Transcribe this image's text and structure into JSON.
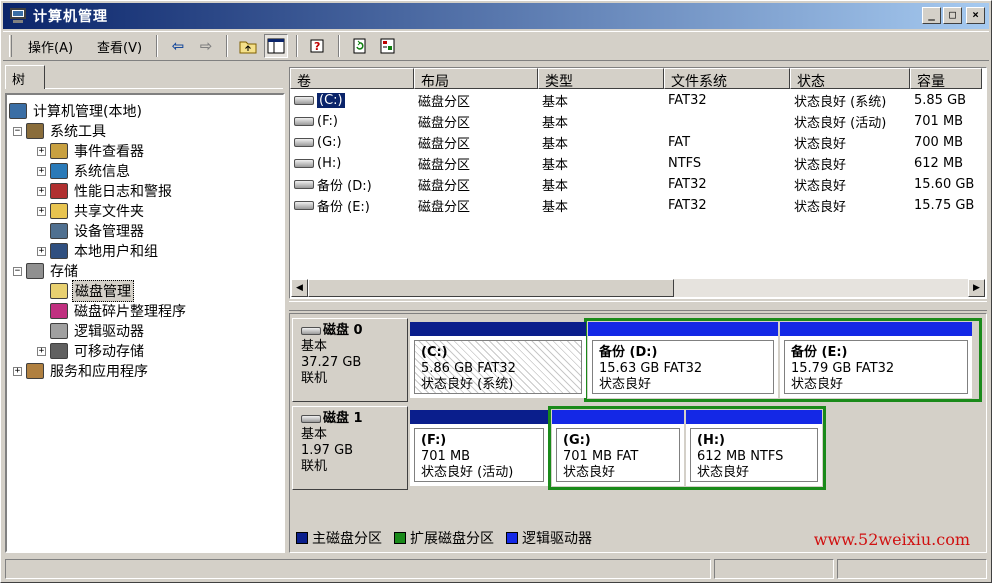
{
  "window": {
    "title": "计算机管理",
    "btn_minimize": "_",
    "btn_maximize": "□",
    "btn_close": "×"
  },
  "menu": {
    "action": "操作(A)",
    "view": "查看(V)"
  },
  "toolbar_icons": [
    "back-arrow-icon",
    "forward-arrow-icon",
    "up-folder-icon",
    "show-tree-icon",
    "help-icon",
    "refresh-icon",
    "properties-icon"
  ],
  "tree": {
    "tab_label": "树",
    "items": [
      {
        "label": "计算机管理(本地)",
        "level": 0,
        "expander": "",
        "icon": "computer-icon"
      },
      {
        "label": "系统工具",
        "level": 1,
        "expander": "−",
        "icon": "tools-icon"
      },
      {
        "label": "事件查看器",
        "level": 2,
        "expander": "+",
        "icon": "event-viewer-icon"
      },
      {
        "label": "系统信息",
        "level": 2,
        "expander": "+",
        "icon": "system-info-icon"
      },
      {
        "label": "性能日志和警报",
        "level": 2,
        "expander": "+",
        "icon": "performance-icon"
      },
      {
        "label": "共享文件夹",
        "level": 2,
        "expander": "+",
        "icon": "shared-folder-icon"
      },
      {
        "label": "设备管理器",
        "level": 2,
        "expander": "",
        "icon": "device-manager-icon"
      },
      {
        "label": "本地用户和组",
        "level": 2,
        "expander": "+",
        "icon": "users-icon"
      },
      {
        "label": "存储",
        "level": 1,
        "expander": "−",
        "icon": "storage-icon"
      },
      {
        "label": "磁盘管理",
        "level": 2,
        "expander": "",
        "icon": "disk-management-icon",
        "selected": true
      },
      {
        "label": "磁盘碎片整理程序",
        "level": 2,
        "expander": "",
        "icon": "defrag-icon"
      },
      {
        "label": "逻辑驱动器",
        "level": 2,
        "expander": "",
        "icon": "logical-drive-icon"
      },
      {
        "label": "可移动存储",
        "level": 2,
        "expander": "+",
        "icon": "removable-storage-icon"
      },
      {
        "label": "服务和应用程序",
        "level": 1,
        "expander": "+",
        "icon": "services-icon"
      }
    ]
  },
  "volumes": {
    "columns": [
      "卷",
      "布局",
      "类型",
      "文件系统",
      "状态",
      "容量"
    ],
    "rows": [
      {
        "volume": "(C:)",
        "layout": "磁盘分区",
        "type": "基本",
        "fs": "FAT32",
        "status": "状态良好 (系统)",
        "capacity": "5.85 GB",
        "selected": true
      },
      {
        "volume": "(F:)",
        "layout": "磁盘分区",
        "type": "基本",
        "fs": "",
        "status": "状态良好 (活动)",
        "capacity": "701 MB"
      },
      {
        "volume": "(G:)",
        "layout": "磁盘分区",
        "type": "基本",
        "fs": "FAT",
        "status": "状态良好",
        "capacity": "700 MB"
      },
      {
        "volume": "(H:)",
        "layout": "磁盘分区",
        "type": "基本",
        "fs": "NTFS",
        "status": "状态良好",
        "capacity": "612 MB"
      },
      {
        "volume": "备份 (D:)",
        "layout": "磁盘分区",
        "type": "基本",
        "fs": "FAT32",
        "status": "状态良好",
        "capacity": "15.60 GB"
      },
      {
        "volume": "备份 (E:)",
        "layout": "磁盘分区",
        "type": "基本",
        "fs": "FAT32",
        "status": "状态良好",
        "capacity": "15.75 GB"
      }
    ]
  },
  "disks": [
    {
      "name": "磁盘 0",
      "type": "基本",
      "size": "37.27 GB",
      "state": "联机",
      "partitions": [
        {
          "title": "(C:)",
          "info": "5.86 GB FAT32",
          "status": "状态良好 (系统)",
          "kind": "primary",
          "selected": true
        },
        {
          "title": "备份  (D:)",
          "info": "15.63 GB FAT32",
          "status": "状态良好",
          "kind": "logical"
        },
        {
          "title": "备份  (E:)",
          "info": "15.79 GB FAT32",
          "status": "状态良好",
          "kind": "logical"
        }
      ]
    },
    {
      "name": "磁盘 1",
      "type": "基本",
      "size": "1.97 GB",
      "state": "联机",
      "partitions": [
        {
          "title": "(F:)",
          "info": "701 MB",
          "status": "状态良好 (活动)",
          "kind": "primary"
        },
        {
          "title": "(G:)",
          "info": "701 MB FAT",
          "status": "状态良好",
          "kind": "logical"
        },
        {
          "title": "(H:)",
          "info": "612 MB NTFS",
          "status": "状态良好",
          "kind": "logical"
        }
      ]
    }
  ],
  "legend": [
    {
      "label": "主磁盘分区",
      "color": "#0a1e8c"
    },
    {
      "label": "扩展磁盘分区",
      "color": "#1a8a1a"
    },
    {
      "label": "逻辑驱动器",
      "color": "#1428e6"
    }
  ],
  "watermark": "www.52weixiu.com",
  "colors": {
    "title_start": "#0a246a",
    "title_end": "#a6caf0",
    "primary": "#0a1e8c",
    "extended": "#1a8a1a",
    "logical": "#1428e6",
    "selection": "#0a246a"
  }
}
